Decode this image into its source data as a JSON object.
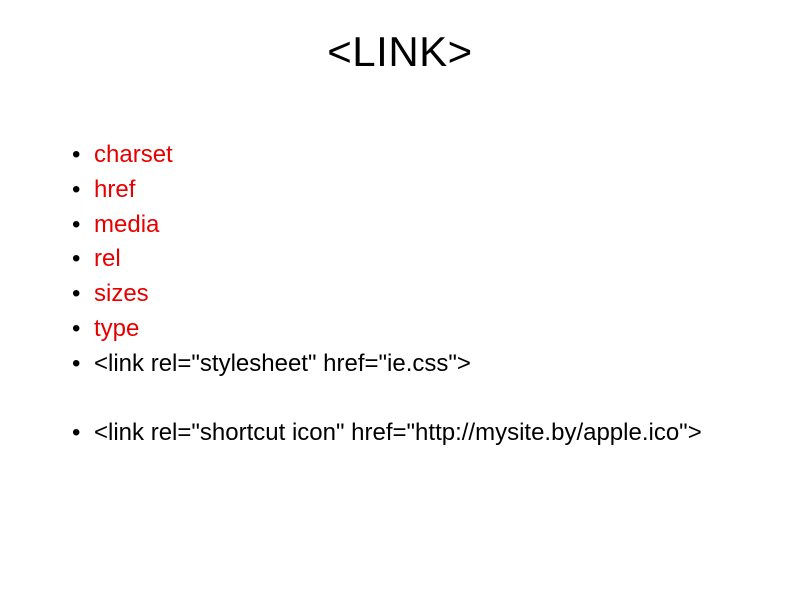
{
  "title": "<LINK>",
  "items": [
    {
      "text": "charset",
      "red": true
    },
    {
      "text": "href",
      "red": true
    },
    {
      "text": "media",
      "red": true
    },
    {
      "text": "rel",
      "red": true
    },
    {
      "text": "sizes",
      "red": true
    },
    {
      "text": "type",
      "red": true
    },
    {
      "text": "<link rel=\"stylesheet\" href=\"ie.css\">",
      "red": false
    },
    {
      "text": "<link rel=\"shortcut icon\" href=\"http://mysite.by/apple.ico\">",
      "red": false,
      "gapBefore": true
    }
  ]
}
